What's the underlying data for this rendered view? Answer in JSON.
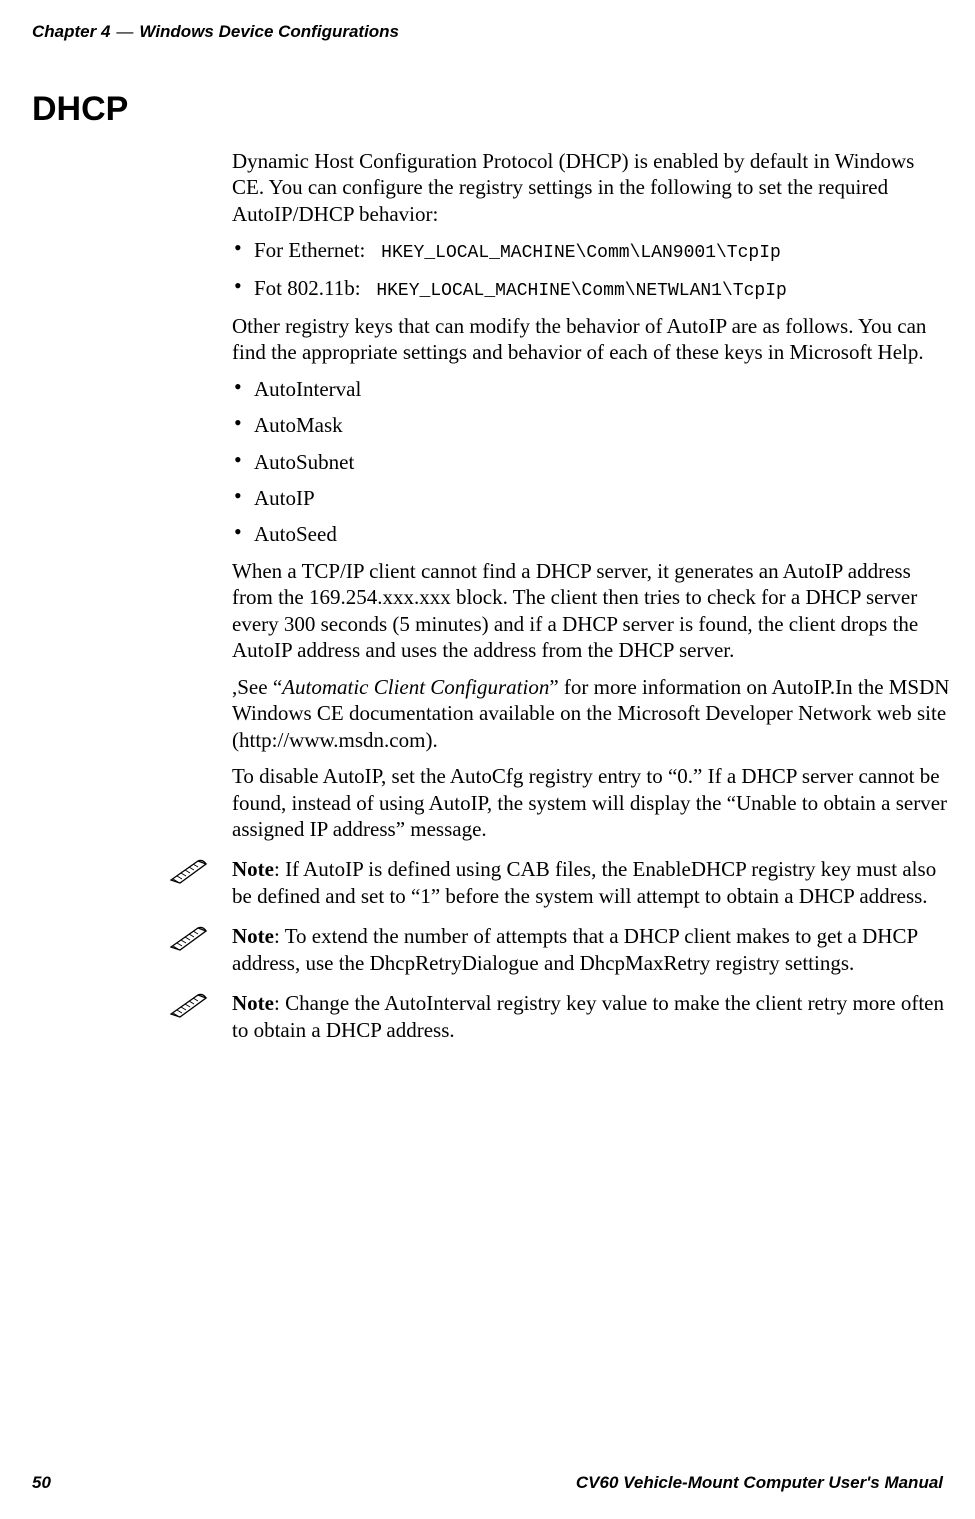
{
  "header": {
    "chapter_prefix": "Chapter 4",
    "dash": "—",
    "chapter_title": "Windows Device Configurations"
  },
  "section": {
    "title": "DHCP"
  },
  "body": {
    "intro": "Dynamic Host Configuration Protocol (DHCP) is enabled by default in Windows CE. You can configure the registry settings in the following to set the required AutoIP/DHCP behavior:",
    "registry_bullets": [
      {
        "label": "For Ethernet:",
        "path": "HKEY_LOCAL_MACHINE\\Comm\\LAN9001\\TcpIp"
      },
      {
        "label": "Fot 802.11b:",
        "path": "HKEY_LOCAL_MACHINE\\Comm\\NETWLAN1\\TcpIp"
      }
    ],
    "other_keys_intro": "Other registry keys that can modify the behavior of AutoIP are as follows. You can find the appropriate settings and behavior of each of these keys in Microsoft Help.",
    "key_bullets": [
      "AutoInterval",
      "AutoMask",
      "AutoSubnet",
      "AutoIP",
      "AutoSeed"
    ],
    "autoip_para": "When a TCP/IP client cannot find a DHCP server, it generates an AutoIP address from the 169.254.xxx.xxx block. The client then tries to check for a DHCP server every 300 seconds (5 minutes) and if a DHCP server is found, the client drops the AutoIP address and uses the address from the DHCP server.",
    "see_para_prefix": ",See “",
    "see_para_italic": "Automatic Client Configuration",
    "see_para_suffix": "” for more information on AutoIP.In the MSDN Windows CE documentation available on the Microsoft Developer Network web site (http://www.msdn.com).",
    "disable_para": "To disable AutoIP, set the AutoCfg registry entry to “0.” If a DHCP server cannot be found, instead of using AutoIP, the system will display the “Unable to obtain a server assigned IP address” message.",
    "notes": [
      {
        "label": "Note",
        "text": ": If AutoIP is defined using CAB files, the EnableDHCP registry key must also be defined and set to “1” before the system will attempt to obtain a DHCP address."
      },
      {
        "label": "Note",
        "text": ": To extend the number of attempts that a DHCP client makes to get a DHCP address, use the DhcpRetryDialogue and DhcpMaxRetry registry settings."
      },
      {
        "label": "Note",
        "text": ": Change the AutoInterval registry key value to make the client retry more often to obtain a DHCP address."
      }
    ]
  },
  "footer": {
    "page_number": "50",
    "manual_title": "CV60 Vehicle-Mount Computer User's Manual"
  }
}
